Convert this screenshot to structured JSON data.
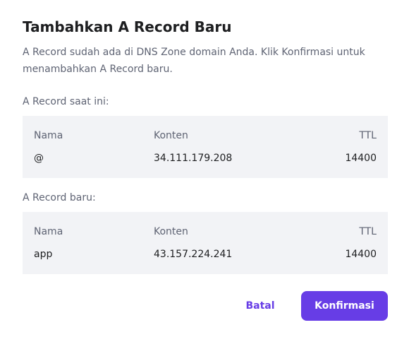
{
  "dialog": {
    "title": "Tambahkan A Record Baru",
    "description": "A Record sudah ada di DNS Zone domain Anda. Klik Konfirmasi untuk menambahkan A Record baru."
  },
  "current_record": {
    "label": "A Record saat ini:",
    "headers": {
      "name": "Nama",
      "content": "Konten",
      "ttl": "TTL"
    },
    "row": {
      "name": "@",
      "content": "34.111.179.208",
      "ttl": "14400"
    }
  },
  "new_record": {
    "label": "A Record baru:",
    "headers": {
      "name": "Nama",
      "content": "Konten",
      "ttl": "TTL"
    },
    "row": {
      "name": "app",
      "content": "43.157.224.241",
      "ttl": "14400"
    }
  },
  "actions": {
    "cancel_label": "Batal",
    "confirm_label": "Konfirmasi"
  },
  "colors": {
    "accent": "#673de6",
    "table_bg": "#f2f3f6",
    "title_text": "#1d1e20",
    "muted_text": "#5e6373"
  }
}
